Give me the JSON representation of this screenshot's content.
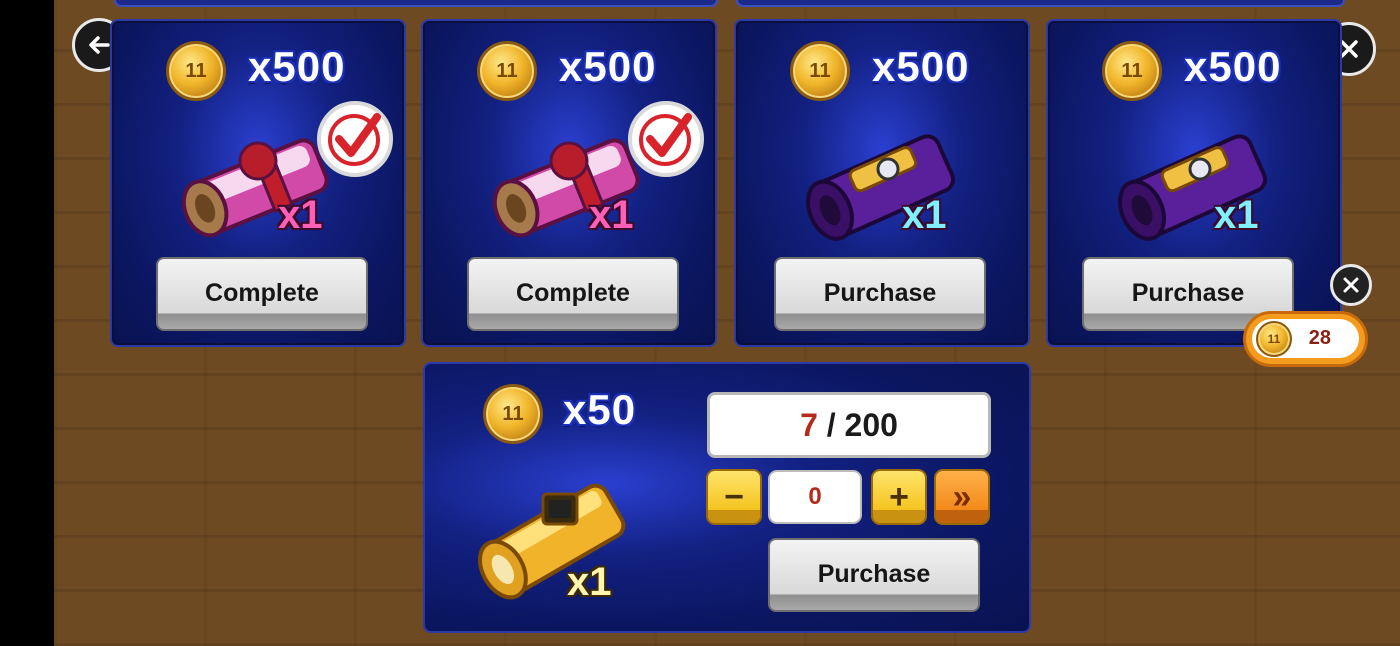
{
  "cards": [
    {
      "price": "x500",
      "coin_text": "11",
      "item_qty": "x1",
      "item": "pink scroll",
      "status": "completed",
      "button": "Complete",
      "qty_color": "#ff5fb5"
    },
    {
      "price": "x500",
      "coin_text": "11",
      "item_qty": "x1",
      "item": "pink scroll",
      "status": "completed",
      "button": "Complete",
      "qty_color": "#ff5fb5"
    },
    {
      "price": "x500",
      "coin_text": "11",
      "item_qty": "x1",
      "item": "purple scroll",
      "status": "available",
      "button": "Purchase",
      "qty_color": "#7ff0ff"
    },
    {
      "price": "x500",
      "coin_text": "11",
      "item_qty": "x1",
      "item": "purple scroll",
      "status": "available",
      "button": "Purchase",
      "qty_color": "#7ff0ff"
    }
  ],
  "bulk": {
    "price": "x50",
    "coin_text": "11",
    "item_qty": "x1",
    "item": "gold scroll",
    "current": "7",
    "separator": " / ",
    "max": "200",
    "quantity": "0",
    "minus": "−",
    "plus": "+",
    "max_icon": "»",
    "button": "Purchase"
  },
  "currency": {
    "balance": "28",
    "coin_text": "11"
  },
  "icons": {
    "back": "arrow-left-icon",
    "close": "close-icon",
    "check": "checkmark-icon"
  },
  "colors": {
    "panel": "#0b1660",
    "border": "#2b3aa8",
    "background": "#6e4a22",
    "accent": "#f39c1e"
  }
}
